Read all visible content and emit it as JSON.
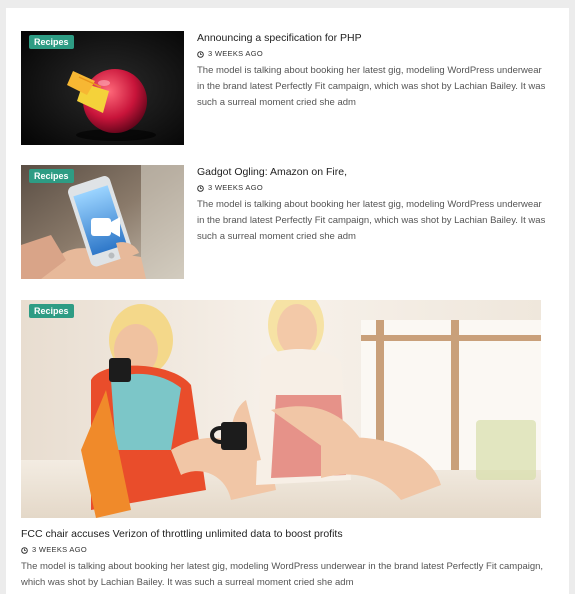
{
  "posts": [
    {
      "category": "Recipes",
      "title": "Announcing a specification for PHP",
      "date": "3 WEEKS AGO",
      "excerpt": "The model is talking about booking her latest gig, modeling WordPress underwear in the brand latest Perfectly Fit campaign, which was shot by Lachian Bailey. It was such a surreal moment cried she adm",
      "image_icon": "apple-photo"
    },
    {
      "category": "Recipes",
      "title": "Gadgot Ogling: Amazon on Fire,",
      "date": "3 WEEKS AGO",
      "excerpt": "The model is talking about booking her latest gig, modeling WordPress underwear in the brand latest Perfectly Fit campaign, which was shot by Lachian Bailey. It was such a surreal moment cried she adm",
      "image_icon": "phone-video-photo"
    }
  ],
  "featured": {
    "category": "Recipes",
    "title": "FCC chair accuses Verizon of throttling unlimited data to boost profits",
    "date": "3 WEEKS AGO",
    "excerpt": "The model is talking about booking her latest gig, modeling WordPress underwear in the brand latest Perfectly Fit campaign, which was shot by Lachian Bailey. It was such a surreal moment cried she adm",
    "image_icon": "two-women-coffee-photo"
  },
  "colors": {
    "badge": "#2e9c84",
    "title": "#222222",
    "excerpt": "#555555",
    "background": "#ececec"
  }
}
